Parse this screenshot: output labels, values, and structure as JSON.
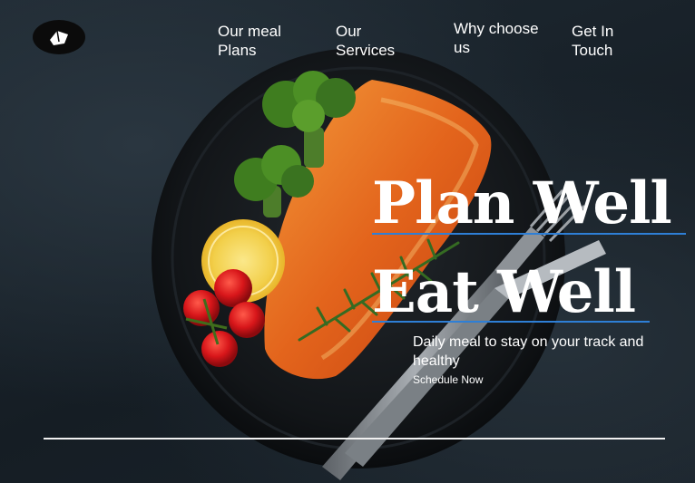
{
  "nav": {
    "items": [
      {
        "label": "Our meal Plans"
      },
      {
        "label": "Our Services"
      },
      {
        "label": "Why choose us"
      },
      {
        "label": "Get In Touch"
      }
    ]
  },
  "hero": {
    "headline_line1": "Plan Well",
    "headline_line2": "Eat Well",
    "tagline": "Daily meal to stay on your track and healthy",
    "cta_label": "Schedule Now"
  },
  "colors": {
    "background": "#1b242c",
    "text": "#ffffff",
    "accent_underline": "#2e7fd6",
    "plate": "#111418"
  },
  "icons": {
    "logo": "leaf-logo-icon"
  }
}
